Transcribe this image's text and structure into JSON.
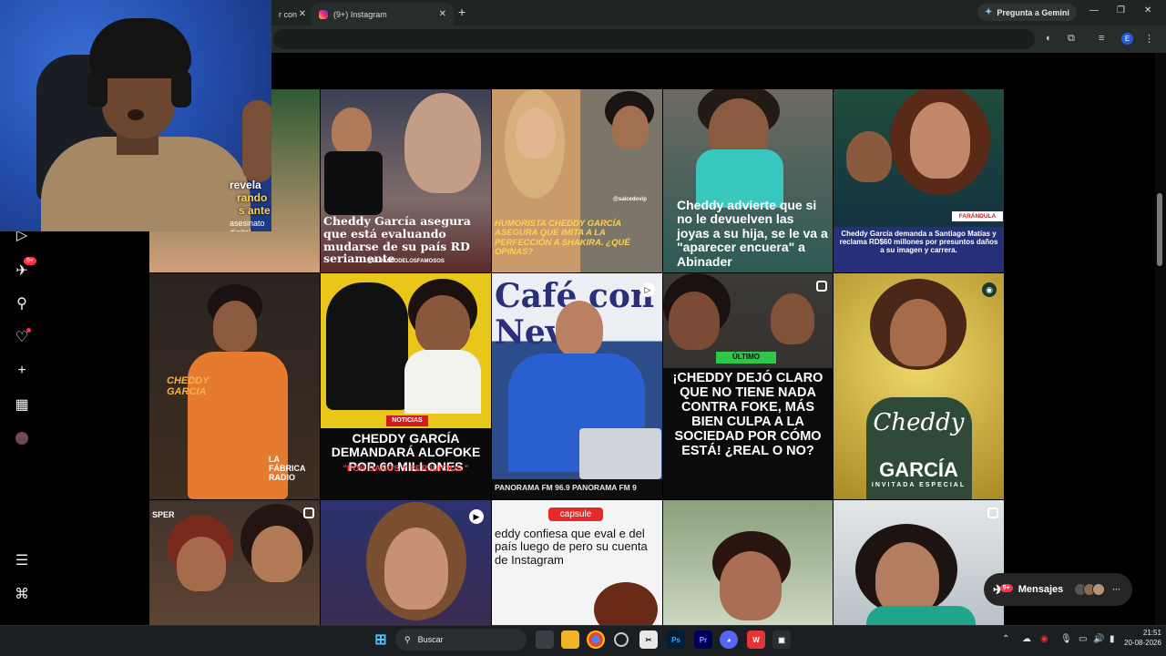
{
  "browser": {
    "tab_prev_text": "r con",
    "tab_active_title": "(9+) Instagram",
    "gemini_label": "Pregunta a Gemini",
    "profile_initial": "E"
  },
  "webcam": {
    "overlay_text_1": "revela",
    "overlay_text_2": "rando",
    "overlay_text_3": "s ante",
    "overlay_text_4": "asesinato digital"
  },
  "sidebar": {
    "notifications_badge": "9+"
  },
  "grid": {
    "row1": {
      "t1_caption": "Cheddy García asegura que está evaluando mudarse de su país RD seriamente",
      "t1_handle": "@ELPASEODELOSFAMOSOS",
      "t2_caption": "HUMORISTA CHEDDY GARCÍA ASEGURA QUE IMITA A LA PERFECCIÓN A SHAKIRA. ¿QUÉ OPINAS?",
      "t2_handle": "@salcedovip",
      "t3_caption": "Cheddy advierte que si no le devuelven las joyas a su hija, se le va a \"aparecer encuera\" a Abinader",
      "t4_tag": "FARÁNDULA",
      "t4_caption": "Cheddy García demanda a Santiago Matías y reclama RD$60 millones por presuntos daños a su imagen y carrera."
    },
    "row2": {
      "t0_logo": "CHEDDY GARCIA",
      "t0_brand": "LA FÁBRICA RADIO",
      "t1_tag": "NOTICIAS",
      "t1_caption": "CHEDDY GARCÍA DEMANDARÁ ALOFOKE POR 60 MILLONES",
      "t1_sub": "\"POR DAÑOS Y PERJUICIOS \"",
      "t2_brand": "Café con Nev",
      "t2_ticker": "PANORAMA FM 96.9 PANORAMA FM 9",
      "t3_tag": "ÚLTIMO",
      "t3_caption": "¡CHEDDY DEJÓ CLARO QUE NO TIENE NADA CONTRA FOKE, MÁS BIEN CULPA A LA SOCIEDAD POR CÓMO ESTÁ! ¿REAL O NO?",
      "t4_script": "Cheddy",
      "t4_name": "GARCÍA",
      "t4_sub": "INVITADA ESPECIAL"
    },
    "row3": {
      "t0_tag": "SPER",
      "t2_tag": "capsule",
      "t2_caption": "eddy confiesa que eval e del país luego de pero su cuenta de Instagram"
    }
  },
  "messages": {
    "label": "Mensajes",
    "badge": "9+"
  },
  "taskbar": {
    "search_label": "Buscar",
    "time": "21:51",
    "date": "20-08-2026"
  }
}
